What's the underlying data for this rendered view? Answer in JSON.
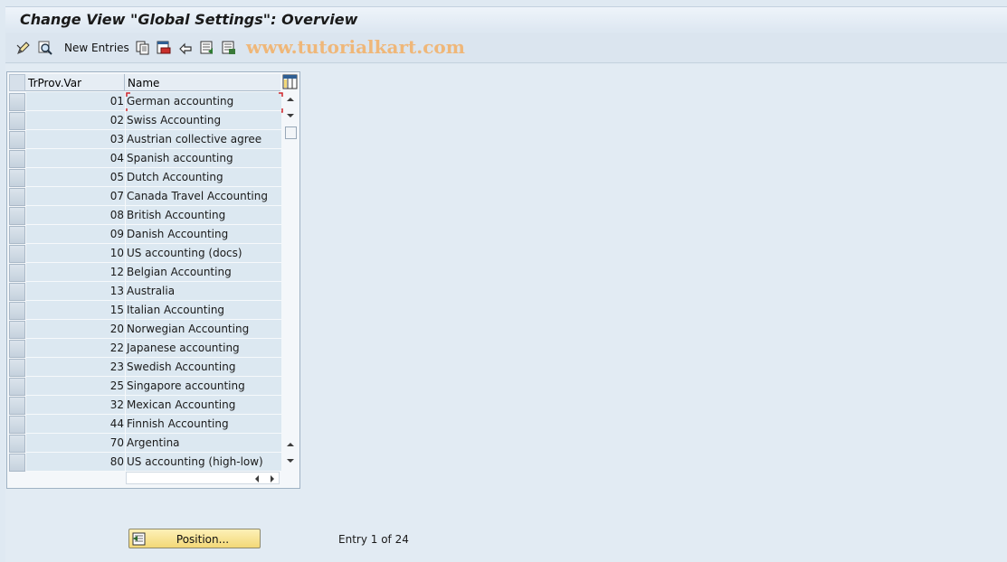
{
  "window": {
    "title": "Change View \"Global Settings\": Overview"
  },
  "toolbar": {
    "new_entries_label": "New Entries",
    "icons": [
      "display-change-icon",
      "find-icon",
      "copy-icon",
      "delete-icon",
      "undo-icon",
      "select-all-icon",
      "select-block-icon"
    ],
    "watermark": "www.tutorialkart.com"
  },
  "table": {
    "columns": [
      "TrProv.Var",
      "Name"
    ],
    "rows": [
      {
        "code": "01",
        "name": "German accounting"
      },
      {
        "code": "02",
        "name": "Swiss Accounting"
      },
      {
        "code": "03",
        "name": "Austrian collective agree"
      },
      {
        "code": "04",
        "name": "Spanish accounting"
      },
      {
        "code": "05",
        "name": "Dutch Accounting"
      },
      {
        "code": "07",
        "name": "Canada Travel Accounting"
      },
      {
        "code": "08",
        "name": "British Accounting"
      },
      {
        "code": "09",
        "name": "Danish Accounting"
      },
      {
        "code": "10",
        "name": "US accounting (docs)"
      },
      {
        "code": "12",
        "name": "Belgian Accounting"
      },
      {
        "code": "13",
        "name": "Australia"
      },
      {
        "code": "15",
        "name": "Italian Accounting"
      },
      {
        "code": "20",
        "name": "Norwegian Accounting"
      },
      {
        "code": "22",
        "name": "Japanese accounting"
      },
      {
        "code": "23",
        "name": "Swedish Accounting"
      },
      {
        "code": "25",
        "name": "Singapore accounting"
      },
      {
        "code": "32",
        "name": "Mexican Accounting"
      },
      {
        "code": "44",
        "name": "Finnish Accounting"
      },
      {
        "code": "70",
        "name": "Argentina"
      },
      {
        "code": "80",
        "name": "US accounting (high-low)"
      }
    ]
  },
  "footer": {
    "position_button_label": "Position...",
    "entry_info": "Entry 1 of 24"
  },
  "colors": {
    "background": "#dfe9f2",
    "cell": "#dce8f1",
    "button": "#f3d877",
    "focus": "#d0262b",
    "watermark": "#efb779"
  }
}
